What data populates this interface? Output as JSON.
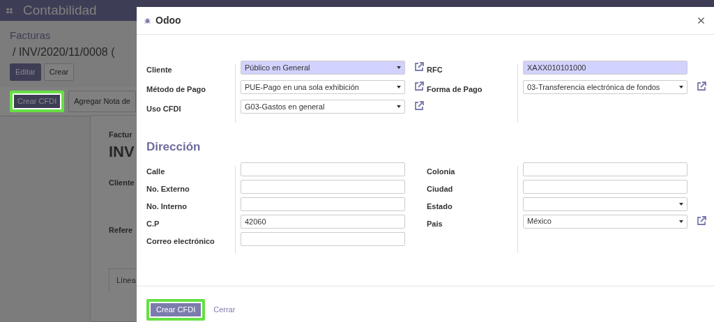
{
  "navbar": {
    "app_title": "Contabilidad"
  },
  "breadcrumb": {
    "title": "Facturas",
    "record": "/ INV/2020/11/0008 ("
  },
  "buttons": [
    {
      "label": "Editar",
      "kind": "primary"
    },
    {
      "label": "Crear",
      "kind": "secondary"
    }
  ],
  "actions": [
    {
      "label": "Crear CFDI",
      "kind": "primary",
      "highlighted": true
    },
    {
      "label": "Agregar Nota de",
      "kind": "secondary",
      "highlighted": false
    }
  ],
  "sheet": {
    "type_label": "Factur",
    "name": "INV",
    "field_labels": [
      "Cliente",
      "Refere"
    ],
    "tab": "Línea"
  },
  "dialog": {
    "title": "Odoo",
    "fields_left": [
      {
        "label": "Cliente",
        "kind": "select",
        "value": "Público en General",
        "required": true,
        "link": true
      },
      {
        "label": "Método de Pago",
        "kind": "select",
        "value": "PUE-Pago en una sola exhibición",
        "required": false,
        "link": true
      },
      {
        "label": "Uso CFDI",
        "kind": "select",
        "value": "G03-Gastos en general",
        "required": false,
        "link": true
      }
    ],
    "fields_right": [
      {
        "label": "RFC",
        "kind": "text",
        "value": "XAXX010101000",
        "required": true,
        "link": false
      },
      {
        "label": "Forma de Pago",
        "kind": "select",
        "value": "03-Transferencia electrónica de fondos",
        "required": false,
        "link": true
      }
    ],
    "section": "Dirección",
    "address_left": [
      {
        "label": "Calle",
        "kind": "text",
        "required": false,
        "link": false
      },
      {
        "label": "No. Externo",
        "kind": "text",
        "required": false,
        "link": false
      },
      {
        "label": "No. Interno",
        "kind": "text",
        "required": false,
        "link": false
      },
      {
        "label": "C.P",
        "kind": "text",
        "value": "42060",
        "required": false,
        "link": false
      },
      {
        "label": "Correo electrónico",
        "kind": "text",
        "required": false,
        "link": false
      }
    ],
    "address_right": [
      {
        "label": "Colonia",
        "kind": "text",
        "required": false,
        "link": false
      },
      {
        "label": "Ciudad",
        "kind": "text",
        "required": false,
        "link": false
      },
      {
        "label": "Estado",
        "kind": "select",
        "required": false,
        "link": false
      },
      {
        "label": "Pais",
        "kind": "select",
        "value": "México",
        "required": false,
        "link": true
      }
    ],
    "footer": [
      {
        "label": "Crear CFDI",
        "kind": "primary",
        "highlighted": true
      },
      {
        "label": "Cerrar",
        "kind": "link",
        "highlighted": false
      }
    ]
  }
}
